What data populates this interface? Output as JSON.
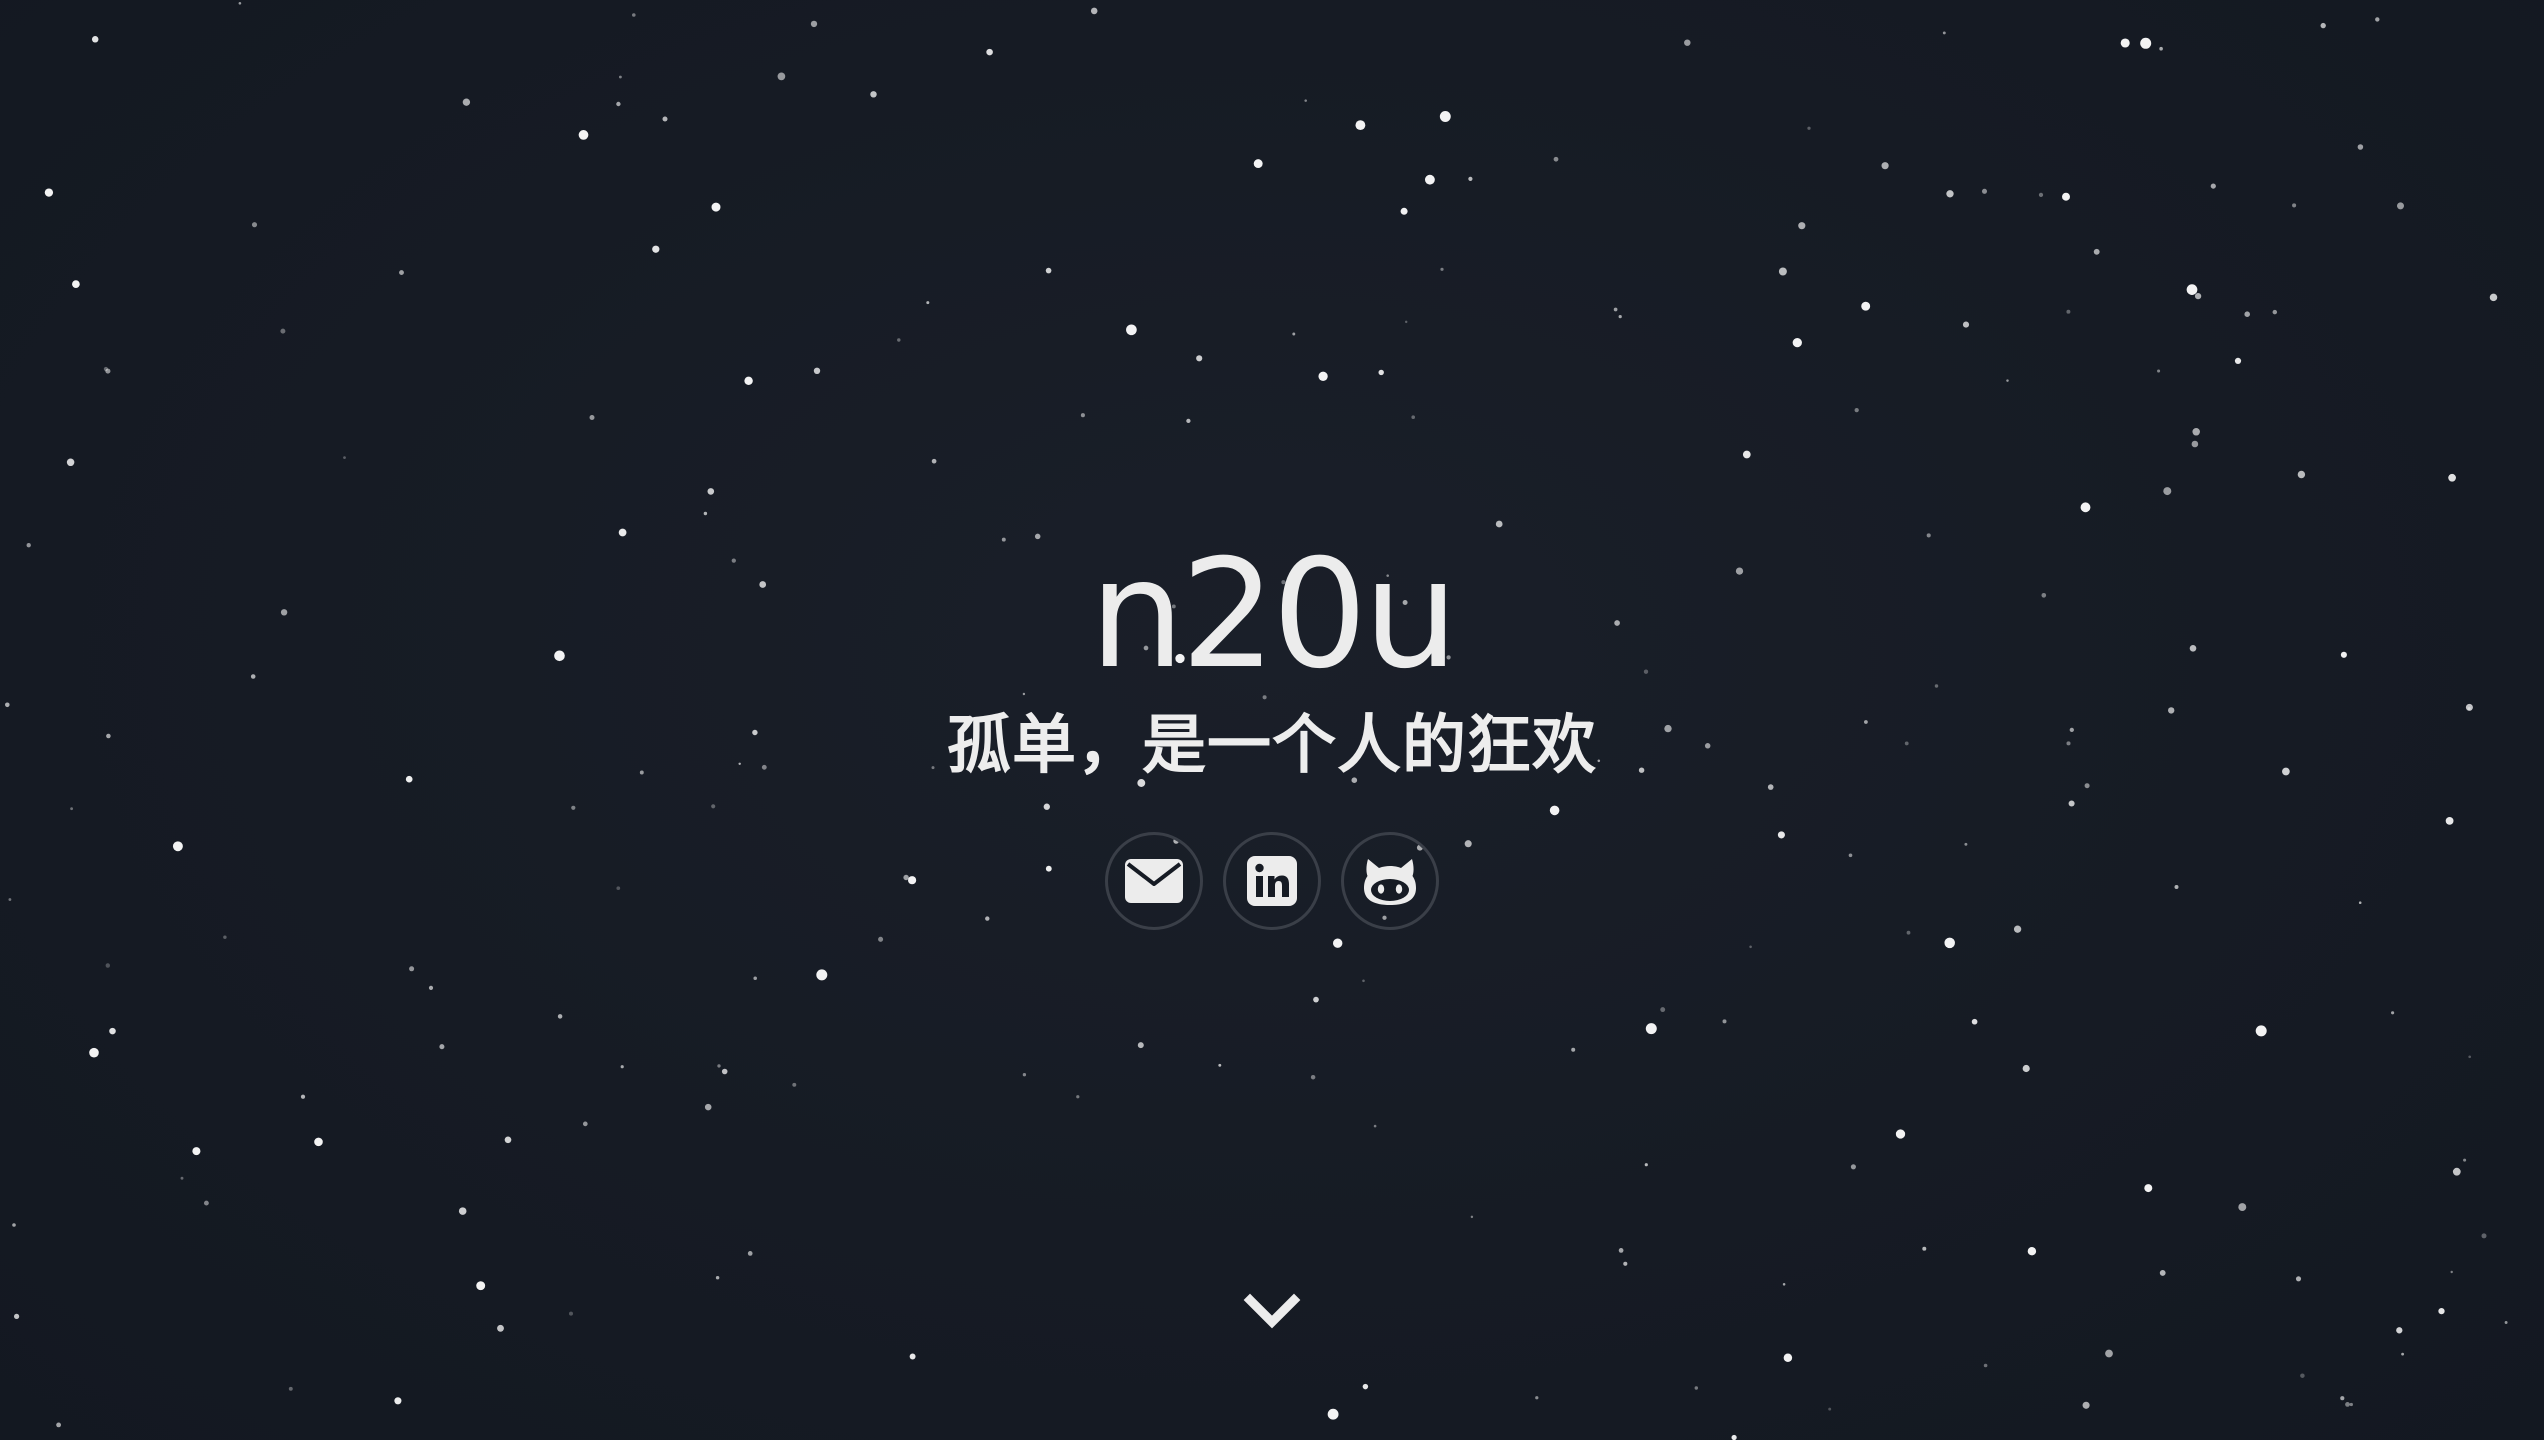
{
  "hero": {
    "title": "n20u",
    "subtitle": "孤单，是一个人的狂欢"
  },
  "social": [
    {
      "name": "email",
      "icon": "envelope-icon"
    },
    {
      "name": "linkedin",
      "icon": "linkedin-icon"
    },
    {
      "name": "github",
      "icon": "github-icon"
    }
  ],
  "scroll": {
    "icon": "chevron-down-icon"
  },
  "colors": {
    "background": "#161b24",
    "text": "#ececec",
    "circle_border": "#3a3f48",
    "star": "#ffffff"
  }
}
